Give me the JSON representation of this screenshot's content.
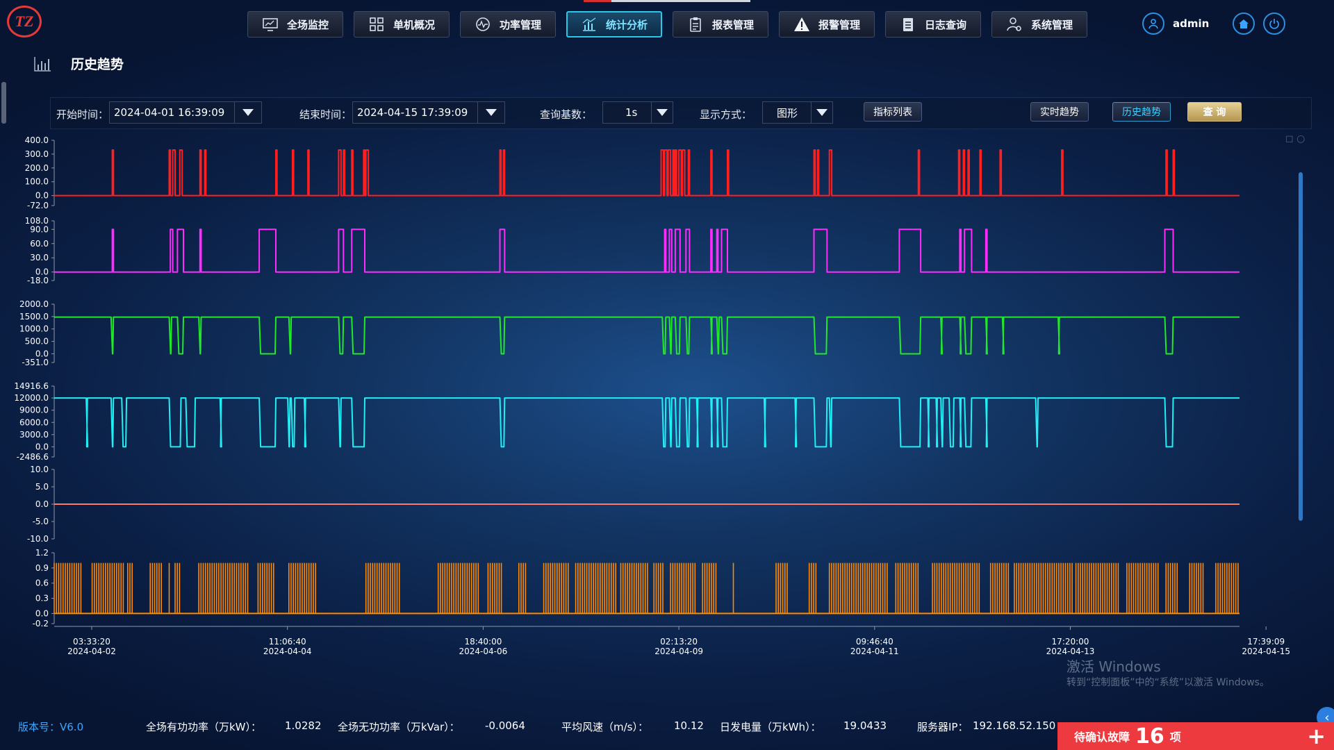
{
  "brand": {
    "logo_text": "TZ"
  },
  "nav": [
    {
      "label": "全场监控",
      "icon": "monitor-icon",
      "active": false
    },
    {
      "label": "单机概况",
      "icon": "grid-icon",
      "active": false
    },
    {
      "label": "功率管理",
      "icon": "gauge-icon",
      "active": false
    },
    {
      "label": "统计分析",
      "icon": "bar-chart-icon",
      "active": true
    },
    {
      "label": "报表管理",
      "icon": "clipboard-icon",
      "active": false
    },
    {
      "label": "报警管理",
      "icon": "warning-icon",
      "active": false
    },
    {
      "label": "日志查询",
      "icon": "document-icon",
      "active": false
    },
    {
      "label": "系统管理",
      "icon": "user-gear-icon",
      "active": false
    }
  ],
  "user": {
    "name": "admin"
  },
  "page": {
    "title": "历史趋势"
  },
  "filters": {
    "start_label": "开始时间：",
    "start_value": "2024-04-01 16:39:09",
    "end_label": "结束时间：",
    "end_value": "2024-04-15 17:39:09",
    "base_label": "查询基数：",
    "base_value": "1s",
    "mode_label": "显示方式：",
    "mode_value": "图形",
    "index_list": "指标列表",
    "realtime": "实时趋势",
    "history": "历史趋势",
    "query": "查 询"
  },
  "colors": {
    "series1": "#ff1f1f",
    "series2": "#ff2bff",
    "series3": "#22e82a",
    "series4": "#1ef0f5",
    "series5": "#ff7a6a",
    "series6": "#ff8a00"
  },
  "chart_data": {
    "type": "line",
    "x_ticks": [
      {
        "time": "03:33:20",
        "date": "2024-04-02"
      },
      {
        "time": "11:06:40",
        "date": "2024-04-04"
      },
      {
        "time": "18:40:00",
        "date": "2024-04-06"
      },
      {
        "time": "02:13:20",
        "date": "2024-04-09"
      },
      {
        "time": "09:46:40",
        "date": "2024-04-11"
      },
      {
        "time": "17:20:00",
        "date": "2024-04-13"
      },
      {
        "time": "17:39:09",
        "date": "2024-04-15"
      }
    ],
    "panels": [
      {
        "ylim": [
          -72.0,
          400.0
        ],
        "y_ticks": [
          "400.0",
          "300.0",
          "200.0",
          "100.0",
          "0.0",
          "-72.0"
        ],
        "baseline": 0,
        "high": 330,
        "color_key": "series1",
        "pulses": [
          [
            0.049,
            0.05
          ],
          [
            0.097,
            0.098
          ],
          [
            0.1,
            0.102
          ],
          [
            0.106,
            0.108
          ],
          [
            0.123,
            0.124
          ],
          [
            0.127,
            0.128
          ],
          [
            0.187,
            0.188
          ],
          [
            0.201,
            0.202
          ],
          [
            0.214,
            0.215
          ],
          [
            0.24,
            0.242
          ],
          [
            0.244,
            0.245
          ],
          [
            0.251,
            0.252
          ],
          [
            0.261,
            0.262
          ],
          [
            0.263,
            0.265
          ],
          [
            0.376,
            0.377
          ],
          [
            0.379,
            0.38
          ],
          [
            0.512,
            0.514
          ],
          [
            0.515,
            0.517
          ],
          [
            0.518,
            0.52
          ],
          [
            0.522,
            0.523
          ],
          [
            0.524,
            0.525
          ],
          [
            0.527,
            0.529
          ],
          [
            0.53,
            0.532
          ],
          [
            0.535,
            0.536
          ],
          [
            0.554,
            0.555
          ],
          [
            0.568,
            0.569
          ],
          [
            0.641,
            0.642
          ],
          [
            0.644,
            0.645
          ],
          [
            0.654,
            0.656
          ],
          [
            0.729,
            0.73
          ],
          [
            0.763,
            0.764
          ],
          [
            0.767,
            0.768
          ],
          [
            0.771,
            0.772
          ],
          [
            0.781,
            0.782
          ],
          [
            0.798,
            0.799
          ],
          [
            0.85,
            0.851
          ],
          [
            0.938,
            0.939
          ],
          [
            0.944,
            0.945
          ]
        ]
      },
      {
        "ylim": [
          -18.0,
          108.0
        ],
        "y_ticks": [
          "108.0",
          "90.0",
          "60.0",
          "30.0",
          "0.0",
          "-18.0"
        ],
        "baseline": 0,
        "high": 90,
        "color_key": "series2",
        "pulses": [
          [
            0.049,
            0.05
          ],
          [
            0.098,
            0.1
          ],
          [
            0.104,
            0.109
          ],
          [
            0.123,
            0.124
          ],
          [
            0.173,
            0.187
          ],
          [
            0.24,
            0.244
          ],
          [
            0.251,
            0.262
          ],
          [
            0.376,
            0.38
          ],
          [
            0.515,
            0.516
          ],
          [
            0.519,
            0.521
          ],
          [
            0.524,
            0.528
          ],
          [
            0.533,
            0.536
          ],
          [
            0.554,
            0.555
          ],
          [
            0.559,
            0.56
          ],
          [
            0.563,
            0.568
          ],
          [
            0.641,
            0.652
          ],
          [
            0.713,
            0.731
          ],
          [
            0.764,
            0.765
          ],
          [
            0.768,
            0.774
          ],
          [
            0.786,
            0.787
          ],
          [
            0.937,
            0.944
          ]
        ]
      },
      {
        "ylim": [
          -351.0,
          2000.0
        ],
        "y_ticks": [
          "2000.0",
          "1500.0",
          "1000.0",
          "500.0",
          "0.0",
          "-351.0"
        ],
        "baseline": 0,
        "high": 1480,
        "inverted": true,
        "color_key": "series3",
        "pulses": [
          [
            0.048,
            0.05
          ],
          [
            0.097,
            0.099
          ],
          [
            0.104,
            0.109
          ],
          [
            0.122,
            0.124
          ],
          [
            0.173,
            0.187
          ],
          [
            0.198,
            0.2
          ],
          [
            0.24,
            0.244
          ],
          [
            0.251,
            0.262
          ],
          [
            0.376,
            0.38
          ],
          [
            0.513,
            0.516
          ],
          [
            0.519,
            0.521
          ],
          [
            0.524,
            0.528
          ],
          [
            0.533,
            0.536
          ],
          [
            0.554,
            0.555
          ],
          [
            0.559,
            0.561
          ],
          [
            0.563,
            0.568
          ],
          [
            0.641,
            0.652
          ],
          [
            0.713,
            0.731
          ],
          [
            0.748,
            0.749
          ],
          [
            0.764,
            0.765
          ],
          [
            0.768,
            0.774
          ],
          [
            0.786,
            0.787
          ],
          [
            0.8,
            0.801
          ],
          [
            0.847,
            0.848
          ],
          [
            0.937,
            0.944
          ]
        ]
      },
      {
        "ylim": [
          -2486.6,
          14916.6
        ],
        "y_ticks": [
          "14916.6",
          "12000.0",
          "9000.0",
          "6000.0",
          "3000.0",
          "0.0",
          "-2486.6"
        ],
        "baseline": 12000,
        "low": 0,
        "inverted": true,
        "color_key": "series4",
        "pulses": [
          [
            0.027,
            0.028
          ],
          [
            0.048,
            0.05
          ],
          [
            0.057,
            0.061
          ],
          [
            0.097,
            0.107
          ],
          [
            0.111,
            0.119
          ],
          [
            0.14,
            0.141
          ],
          [
            0.173,
            0.187
          ],
          [
            0.197,
            0.199
          ],
          [
            0.2,
            0.203
          ],
          [
            0.211,
            0.212
          ],
          [
            0.24,
            0.242
          ],
          [
            0.251,
            0.262
          ],
          [
            0.376,
            0.38
          ],
          [
            0.513,
            0.516
          ],
          [
            0.519,
            0.521
          ],
          [
            0.524,
            0.528
          ],
          [
            0.533,
            0.536
          ],
          [
            0.542,
            0.543
          ],
          [
            0.554,
            0.555
          ],
          [
            0.559,
            0.56
          ],
          [
            0.563,
            0.568
          ],
          [
            0.599,
            0.6
          ],
          [
            0.625,
            0.626
          ],
          [
            0.641,
            0.652
          ],
          [
            0.654,
            0.656
          ],
          [
            0.713,
            0.731
          ],
          [
            0.737,
            0.738
          ],
          [
            0.744,
            0.745
          ],
          [
            0.748,
            0.75
          ],
          [
            0.755,
            0.759
          ],
          [
            0.764,
            0.765
          ],
          [
            0.768,
            0.774
          ],
          [
            0.786,
            0.787
          ],
          [
            0.828,
            0.83
          ],
          [
            0.937,
            0.944
          ]
        ]
      },
      {
        "ylim": [
          -10.0,
          10.0
        ],
        "y_ticks": [
          "10.0",
          "5.0",
          "0.0",
          "-5.0",
          "-10.0"
        ],
        "baseline": 0,
        "color_key": "series5",
        "pulses": []
      },
      {
        "ylim": [
          -0.2,
          1.2
        ],
        "y_ticks": [
          "1.2",
          "0.9",
          "0.6",
          "0.3",
          "0.0",
          "-0.2"
        ],
        "baseline": 0,
        "high": 1,
        "color_key": "series6",
        "bands": [
          [
            0.0,
            0.024
          ],
          [
            0.032,
            0.059
          ],
          [
            0.062,
            0.066
          ],
          [
            0.081,
            0.092
          ],
          [
            0.097,
            0.098
          ],
          [
            0.102,
            0.107
          ],
          [
            0.122,
            0.165
          ],
          [
            0.172,
            0.187
          ],
          [
            0.198,
            0.222
          ],
          [
            0.263,
            0.292
          ],
          [
            0.324,
            0.359
          ],
          [
            0.366,
            0.378
          ],
          [
            0.392,
            0.398
          ],
          [
            0.413,
            0.434
          ],
          [
            0.44,
            0.475
          ],
          [
            0.478,
            0.502
          ],
          [
            0.506,
            0.514
          ],
          [
            0.52,
            0.542
          ],
          [
            0.547,
            0.56
          ],
          [
            0.573,
            0.572
          ],
          [
            0.609,
            0.619
          ],
          [
            0.637,
            0.643
          ],
          [
            0.654,
            0.703
          ],
          [
            0.71,
            0.73
          ],
          [
            0.741,
            0.782
          ],
          [
            0.79,
            0.806
          ],
          [
            0.81,
            0.859
          ],
          [
            0.862,
            0.899
          ],
          [
            0.905,
            0.932
          ],
          [
            0.938,
            0.948
          ],
          [
            0.958,
            0.97
          ],
          [
            0.98,
            1.0
          ]
        ]
      }
    ]
  },
  "watermark": {
    "line1": "激活 Windows",
    "line2": "转到“控制面板”中的“系统”以激活 Windows。"
  },
  "status": {
    "version": "版本号：V6.0",
    "active_power_label": "全场有功功率（万kW）：",
    "active_power_value": "1.0282",
    "reactive_power_label": "全场无功功率（万kVar）：",
    "reactive_power_value": "-0.0064",
    "wind_label": "平均风速（m/s）：",
    "wind_value": "10.12",
    "energy_label": "日发电量（万kWh）：",
    "energy_value": "19.0433",
    "server_label": "服务器IP：",
    "server_value": "192.168.52.150"
  },
  "alarm": {
    "prefix": "待确认故障",
    "count": "16",
    "suffix": "项"
  }
}
